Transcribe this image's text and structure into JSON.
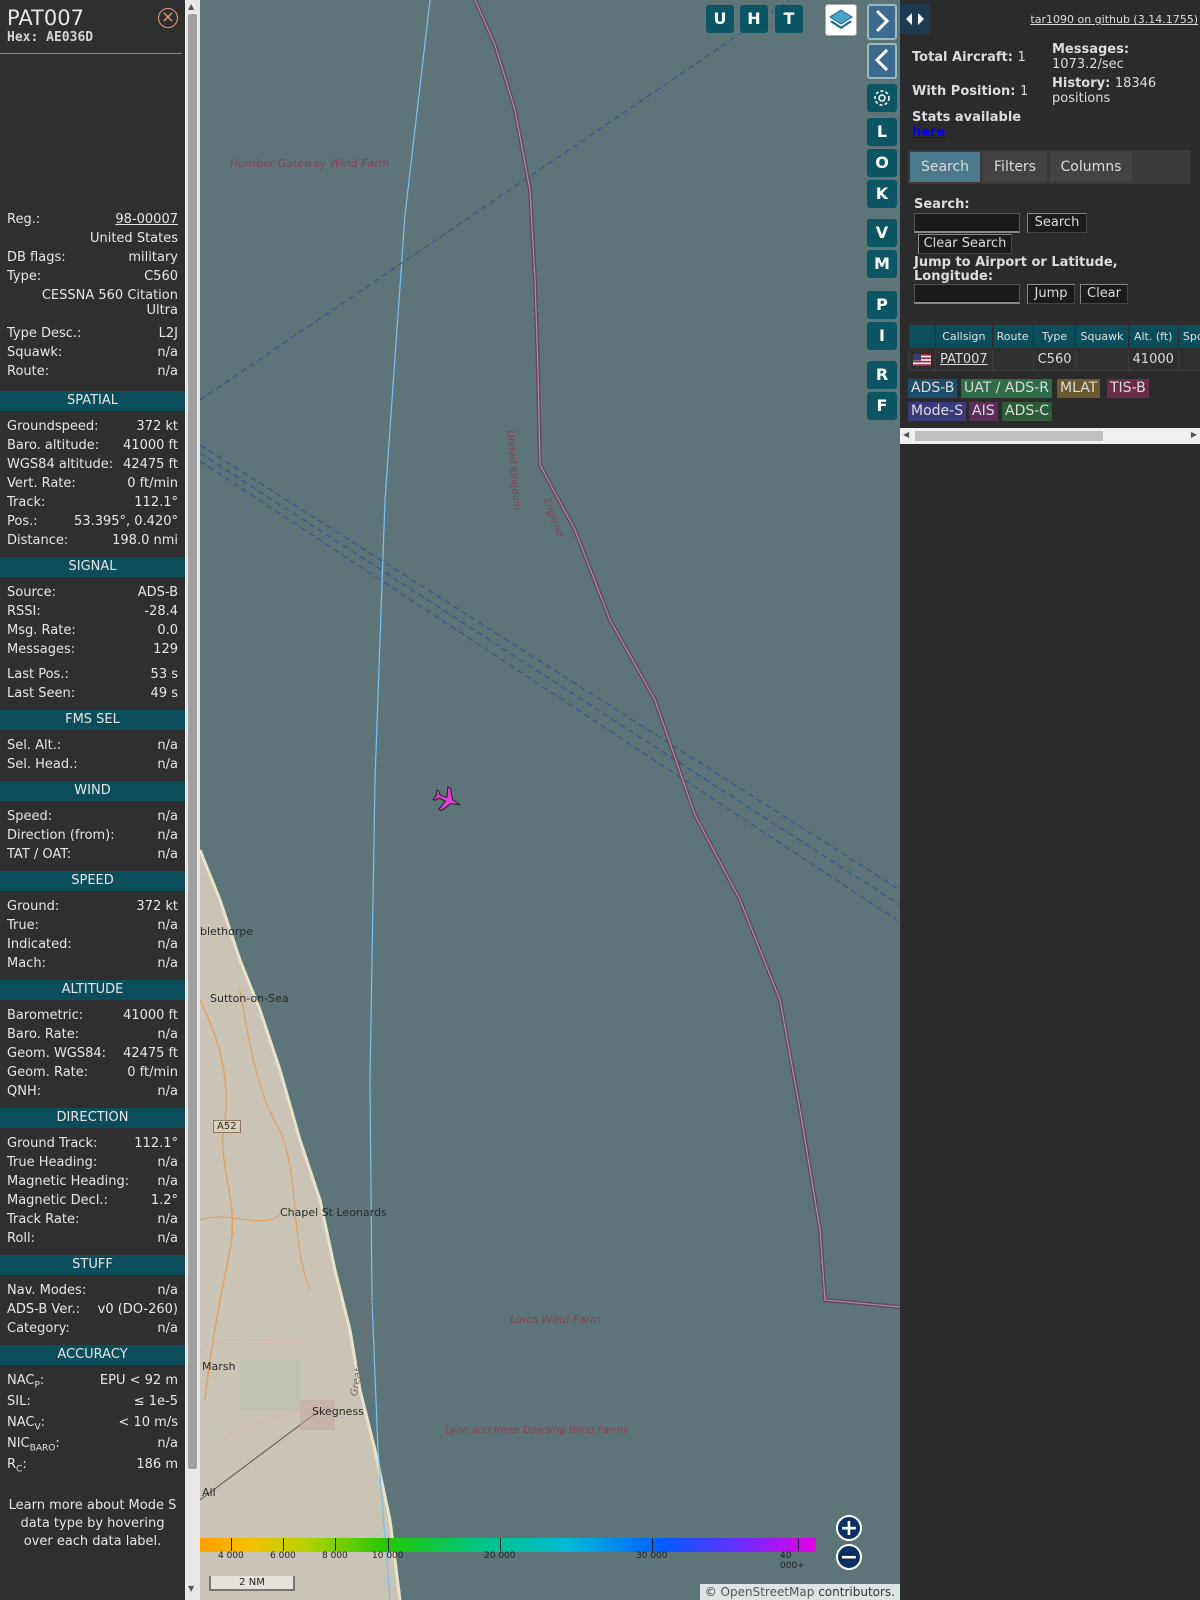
{
  "aircraft": {
    "callsign": "PAT007",
    "hex": "Hex: AE036D",
    "details": [
      {
        "label": "Reg.:",
        "value": "98-00007"
      },
      {
        "label": "",
        "value": "United States"
      },
      {
        "label": "DB flags:",
        "value": "military"
      },
      {
        "label": "Type:",
        "value": "C560"
      },
      {
        "label": "",
        "value": "CESSNA 560 Citation Ultra"
      },
      {
        "label": "Type Desc.:",
        "value": "L2J"
      },
      {
        "label": "Squawk:",
        "value": "n/a"
      },
      {
        "label": "Route:",
        "value": "n/a"
      }
    ]
  },
  "sections": {
    "spatial": {
      "title": "SPATIAL",
      "rows": [
        {
          "label": "Groundspeed:",
          "value": "372 kt"
        },
        {
          "label": "Baro. altitude:",
          "value": "41000 ft"
        },
        {
          "label": "WGS84 altitude:",
          "value": "42475 ft"
        },
        {
          "label": "Vert. Rate:",
          "value": "0 ft/min"
        },
        {
          "label": "Track:",
          "value": "112.1°"
        },
        {
          "label": "Pos.:",
          "value": "53.395°, 0.420°"
        },
        {
          "label": "Distance:",
          "value": "198.0 nmi"
        }
      ]
    },
    "signal": {
      "title": "SIGNAL",
      "rows": [
        {
          "label": "Source:",
          "value": "ADS-B"
        },
        {
          "label": "RSSI:",
          "value": "-28.4"
        },
        {
          "label": "Msg. Rate:",
          "value": "0.0"
        },
        {
          "label": "Messages:",
          "value": "129"
        },
        {
          "label": "Last Pos.:",
          "value": "53 s"
        },
        {
          "label": "Last Seen:",
          "value": "49 s"
        }
      ]
    },
    "fms": {
      "title": "FMS SEL",
      "rows": [
        {
          "label": "Sel. Alt.:",
          "value": "n/a"
        },
        {
          "label": "Sel. Head.:",
          "value": "n/a"
        }
      ]
    },
    "wind": {
      "title": "WIND",
      "rows": [
        {
          "label": "Speed:",
          "value": "n/a"
        },
        {
          "label": "Direction (from):",
          "value": "n/a"
        },
        {
          "label": "TAT / OAT:",
          "value": "n/a"
        }
      ]
    },
    "speed": {
      "title": "SPEED",
      "rows": [
        {
          "label": "Ground:",
          "value": "372 kt"
        },
        {
          "label": "True:",
          "value": "n/a"
        },
        {
          "label": "Indicated:",
          "value": "n/a"
        },
        {
          "label": "Mach:",
          "value": "n/a"
        }
      ]
    },
    "altitude": {
      "title": "ALTITUDE",
      "rows": [
        {
          "label": "Barometric:",
          "value": "41000 ft"
        },
        {
          "label": "Baro. Rate:",
          "value": "n/a"
        },
        {
          "label": "Geom. WGS84:",
          "value": "42475 ft"
        },
        {
          "label": "Geom. Rate:",
          "value": "0 ft/min"
        },
        {
          "label": "QNH:",
          "value": "n/a"
        }
      ]
    },
    "direction": {
      "title": "DIRECTION",
      "rows": [
        {
          "label": "Ground Track:",
          "value": "112.1°"
        },
        {
          "label": "True Heading:",
          "value": "n/a"
        },
        {
          "label": "Magnetic Heading:",
          "value": "n/a"
        },
        {
          "label": "Magnetic Decl.:",
          "value": "1.2°"
        },
        {
          "label": "Track Rate:",
          "value": "n/a"
        },
        {
          "label": "Roll:",
          "value": "n/a"
        }
      ]
    },
    "stuff": {
      "title": "STUFF",
      "rows": [
        {
          "label": "Nav. Modes:",
          "value": "n/a"
        },
        {
          "label": "ADS-B Ver.:",
          "value": "v0 (DO-260)"
        },
        {
          "label": "Category:",
          "value": "n/a"
        }
      ]
    },
    "accuracy": {
      "title": "ACCURACY",
      "rows": [
        {
          "label": "NAC",
          "sub": "P",
          "value": "EPU < 92 m"
        },
        {
          "label": "SIL:",
          "sub": "",
          "value": "≤ 1e-5"
        },
        {
          "label": "NAC",
          "sub": "V",
          "value": "< 10 m/s"
        },
        {
          "label": "NIC",
          "sub": "BARO",
          "value": "n/a"
        },
        {
          "label": "R",
          "sub": "C",
          "value": "186 m"
        }
      ]
    },
    "note": "Learn more about Mode S data type by hovering over each data label."
  },
  "map": {
    "labels": {
      "humber": "Humber Gateway Wind Farm",
      "uk": "United Kingdom",
      "england": "England",
      "blethorpe": "blethorpe",
      "sutton": "Sutton-on-Sea",
      "a52": "A52",
      "chapel": "Chapel St Leonards",
      "lincs": "Lincs Wind Farm",
      "greater_lincs": "Greater Lincolnshire",
      "marsh": "Marsh",
      "skegness": "Skegness",
      "lynn": "Lynn and Inner Dowsing Wind Farms",
      "all": "All"
    },
    "top_buttons": [
      "U",
      "H",
      "T"
    ],
    "side_buttons": [
      "L",
      "O",
      "K",
      "V",
      "M",
      "P",
      "I",
      "R",
      "F"
    ],
    "layers_icon": "layers-icon",
    "scale": "2 NM",
    "attribution_prefix": "© ",
    "attribution_link": "OpenStreetMap",
    "attribution_suffix": " contributors.",
    "altitude_ticks": [
      "4 000",
      "6 000",
      "8 000",
      "10 000",
      "20 000",
      "30 000",
      "40 000+"
    ]
  },
  "right": {
    "github": "tar1090 on github (3.14.1755)",
    "total_aircraft_label": "Total Aircraft:",
    "total_aircraft": "1",
    "messages_label": "Messages:",
    "messages": "1073.2/sec",
    "with_position_label": "With Position:",
    "with_position": "1",
    "history_label": "History:",
    "history": "18346 positions",
    "stats_label": "Stats available",
    "stats_link": "here",
    "tabs": [
      "Search",
      "Filters",
      "Columns"
    ],
    "search_label": "Search:",
    "search_button": "Search",
    "clear_search_button": "Clear Search",
    "jump_label": "Jump to Airport or Latitude, Longitude:",
    "jump_button": "Jump",
    "clear_button": "Clear",
    "columns": [
      "",
      "Callsign",
      "Route",
      "Type",
      "Squawk",
      "Alt. (ft)",
      "Spd."
    ],
    "rows": [
      {
        "callsign": "PAT007",
        "route": "",
        "type": "C560",
        "squawk": "",
        "alt": "41000",
        "spd": ""
      }
    ],
    "legend": [
      {
        "label": "ADS-B",
        "color": "#1e4d6b"
      },
      {
        "label": "UAT / ADS-R",
        "color": "#2e6b48"
      },
      {
        "label": "MLAT",
        "color": "#6b5a2e"
      },
      {
        "label": "TIS-B",
        "color": "#6b2e48"
      },
      {
        "label": "Mode-S",
        "color": "#3a3a7a"
      },
      {
        "label": "AIS",
        "color": "#5a2e5a"
      },
      {
        "label": "ADS-C",
        "color": "#2e5a3a"
      }
    ]
  }
}
